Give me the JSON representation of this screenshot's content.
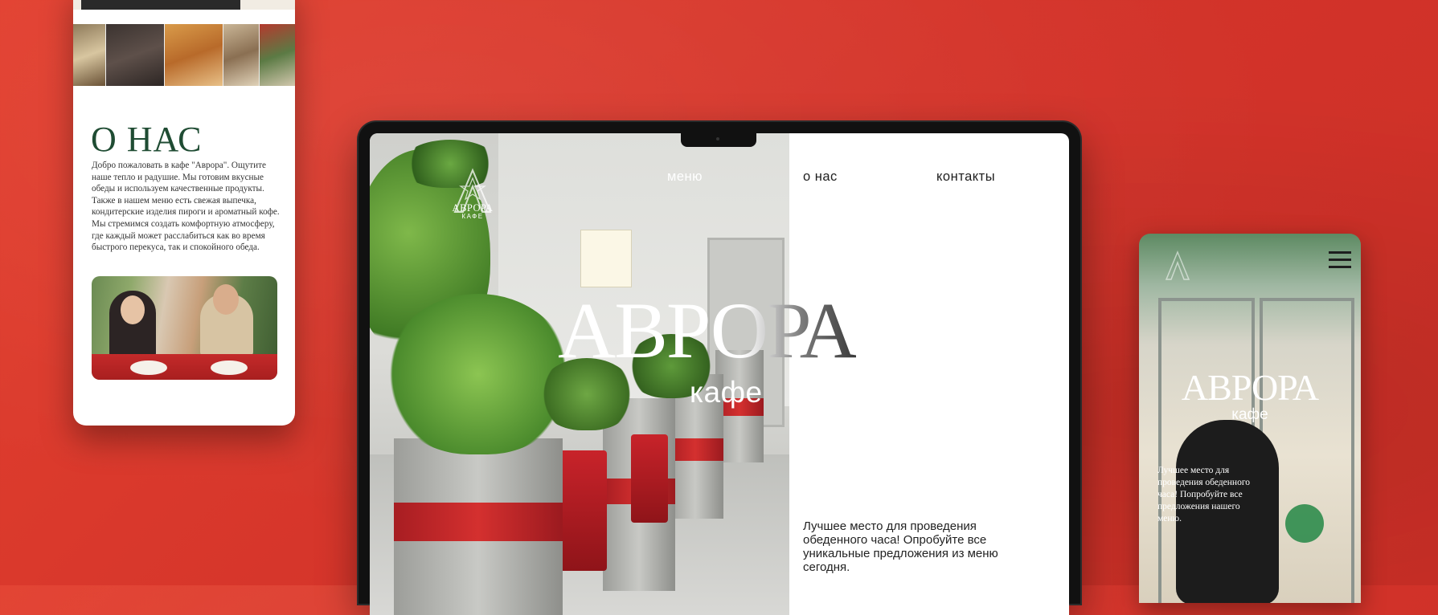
{
  "brand": {
    "name": "АВРОРА",
    "subtitle": "кафе",
    "logo_text": "АВРОРА",
    "logo_sub": "КАФЕ"
  },
  "about_phone": {
    "title": "О НАС",
    "paragraph1": "Добро пожаловать в кафе \"Аврора\". Ощутите наше тепло и радушие. Мы готовим вкусные обеды и используем качественные продукты. Также в нашем меню есть свежая выпечка, кондитерские изделия пироги и ароматный кофе.",
    "paragraph2": "Мы стремимся создать комфортную атмосферу, где каждый может расслабиться как во время быстрого перекуса, так и спокойного обеда."
  },
  "laptop": {
    "nav": [
      "меню",
      "о нас",
      "контакты"
    ],
    "tagline": "Лучшее место для проведения обеденного часа! Опробуйте все уникальные предложения из меню сегодня."
  },
  "mobile_phone": {
    "menu_icon": "hamburger-menu-icon",
    "tagline": "Лучшее место для проведения обеденного часа! Попробуйте все предложения нашего меню."
  },
  "colors": {
    "background": "#dd3a2e",
    "title_green": "#1f4c33",
    "accent_red": "#c8232a"
  }
}
